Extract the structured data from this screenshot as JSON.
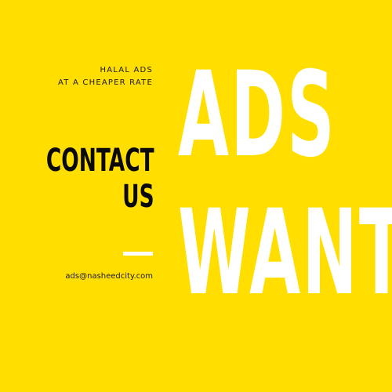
{
  "tagline": {
    "line1": "HALAL ADS",
    "line2": "AT A CHEAPER RATE"
  },
  "contact": {
    "line1": "CONTACT",
    "line2": "US"
  },
  "email": "ads@nasheedcity.com",
  "headline": {
    "line1": "ADS",
    "line2": "WANTED"
  },
  "colors": {
    "background": "#ffde00",
    "headline": "#ffffff",
    "text": "#0a0a0a"
  }
}
